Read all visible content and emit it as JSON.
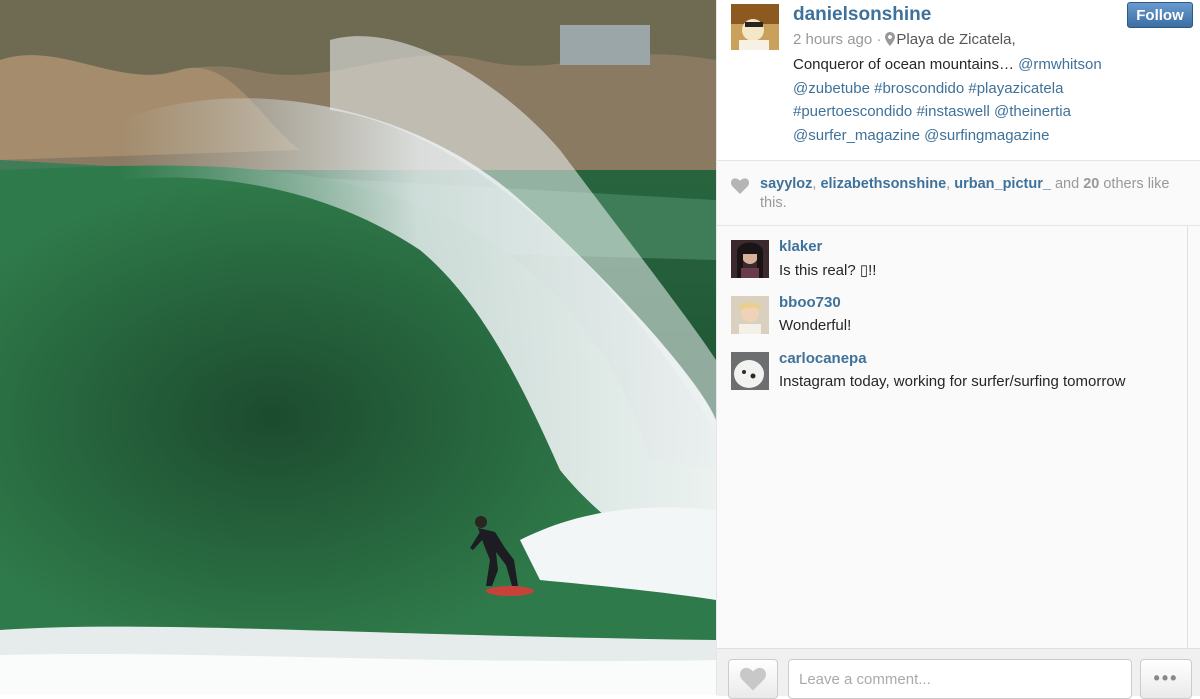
{
  "post": {
    "username": "danielsonshine",
    "follow_label": "Follow",
    "time_ago": "2 hours ago",
    "separator": "·",
    "location": "Playa de Zicatela,",
    "caption_text": "Conqueror of ocean mountains…",
    "caption_tags": [
      "@rmwhitson",
      "@zubetube",
      "#broscondido",
      "#playazicatela",
      "#puertoescondido",
      "#instaswell",
      "@theinertia",
      "@surfer_magazine",
      "@surfingmagazine"
    ]
  },
  "likes": {
    "users": [
      "sayyloz",
      "elizabethsonshine",
      "urban_pictur_"
    ],
    "and_text": "and",
    "others_count": "20",
    "suffix": "others like this."
  },
  "comments": [
    {
      "user": "klaker",
      "text": "Is this real? ▯!!"
    },
    {
      "user": "bboo730",
      "text": "Wonderful!"
    },
    {
      "user": "carlocanepa",
      "text": "Instagram today, working for surfer/surfing tomorrow"
    }
  ],
  "footer": {
    "comment_placeholder": "Leave a comment...",
    "more_label": "•••"
  },
  "colors": {
    "link": "#3f729b",
    "follow_button": "#3b6ea3"
  },
  "icons": [
    "heart-icon",
    "location-pin-icon",
    "more-icon"
  ]
}
